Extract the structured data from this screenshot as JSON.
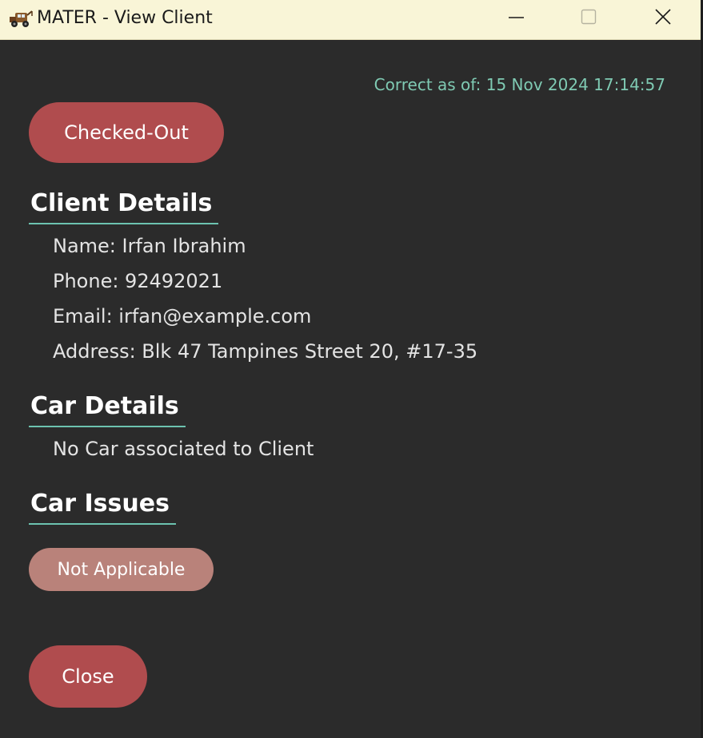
{
  "window": {
    "title": "MATER - View Client",
    "icon": "tow-truck-icon"
  },
  "timestamp": "Correct as of: 15 Nov 2024 17:14:57",
  "status": "Checked-Out",
  "client_details": {
    "heading": "Client Details",
    "name": "Name: Irfan Ibrahim",
    "phone": "Phone: 92492021",
    "email": "Email: irfan@example.com",
    "address": "Address: Blk 47 Tampines Street 20, #17-35"
  },
  "car_details": {
    "heading": "Car Details",
    "message": "No Car associated to Client"
  },
  "car_issues": {
    "heading": "Car Issues",
    "badge": "Not Applicable"
  },
  "close_label": "Close",
  "colors": {
    "background": "#2b2b2b",
    "titlebar": "#f9f5d7",
    "accent_teal": "#6cc3b0",
    "status_red": "#b04c4e",
    "issue_badge": "#b9827a"
  }
}
